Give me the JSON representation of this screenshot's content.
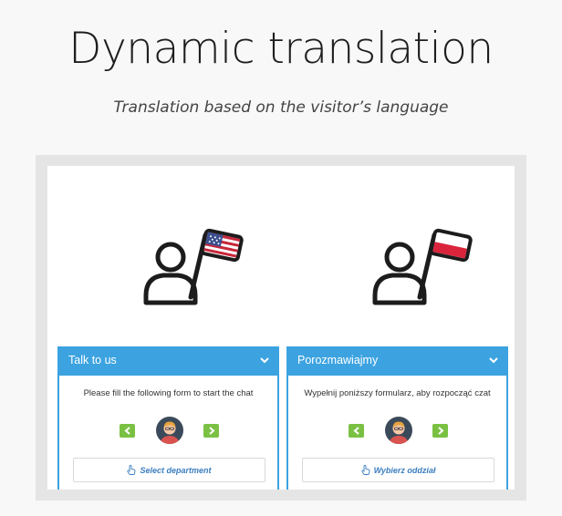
{
  "header": {
    "title": "Dynamic translation",
    "subtitle": "Translation based on the visitor’s language"
  },
  "colors": {
    "accent": "#3ca3e0",
    "nav_button": "#7ac143",
    "link": "#3c7fc0",
    "frame": "#e5e5e5"
  },
  "panels": [
    {
      "flag": "us-flag-icon",
      "title": "Talk to us",
      "message": "Please fill the following form to start the chat",
      "department_label": "Select department"
    },
    {
      "flag": "pl-flag-icon",
      "title": "Porozmawiajmy",
      "message": "Wypełnij poniższy formularz, aby rozpocząć czat",
      "department_label": "Wybierz oddział"
    }
  ]
}
